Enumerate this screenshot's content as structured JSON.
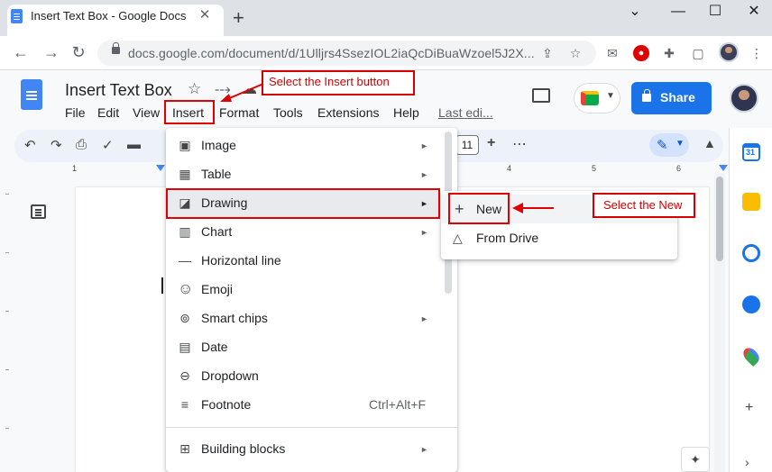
{
  "browser": {
    "tab_title": "Insert Text Box - Google Docs",
    "tab_close": "✕",
    "new_tab": "+",
    "window_controls": {
      "chevron": "⌄",
      "minimize": "—",
      "maximize": "☐",
      "close": "✕"
    },
    "nav": {
      "back": "←",
      "forward": "→",
      "reload": "↻"
    },
    "url": "docs.google.com/document/d/1Ulljrs4SsezIOL2iaQcDiBuaWzoel5J2X...",
    "extension_icons": [
      "share-icon",
      "bookmark-star-icon",
      "mail-icon",
      "adblock-icon",
      "puzzle-extensions-icon",
      "sidebar-icon",
      "more-vert-icon"
    ]
  },
  "docs": {
    "title": "Insert Text Box",
    "title_icons": {
      "star": "☆",
      "move": "⤏",
      "cloud": "☁"
    },
    "menus": [
      "File",
      "Edit",
      "View",
      "Insert",
      "Format",
      "Tools",
      "Extensions",
      "Help"
    ],
    "last_edit": "Last edi...",
    "share_label": "Share",
    "font_size": "11",
    "plus_label": "+",
    "more_label": "⋮",
    "ruler_numbers": [
      "1",
      "4",
      "5",
      "6"
    ]
  },
  "insert_menu": {
    "items": [
      {
        "label": "Image",
        "icon": "image-icon",
        "glyph": "▣",
        "submenu": true
      },
      {
        "label": "Table",
        "icon": "table-icon",
        "glyph": "▦",
        "submenu": true
      },
      {
        "label": "Drawing",
        "icon": "drawing-icon",
        "glyph": "◪",
        "submenu": true
      },
      {
        "label": "Chart",
        "icon": "chart-icon",
        "glyph": "▥",
        "submenu": true
      },
      {
        "label": "Horizontal line",
        "icon": "horizontal-line-icon",
        "glyph": "—",
        "submenu": false
      },
      {
        "label": "Emoji",
        "icon": "emoji-icon",
        "glyph": "☺",
        "submenu": false
      },
      {
        "label": "Smart chips",
        "icon": "smart-chips-icon",
        "glyph": "⊚",
        "submenu": true
      },
      {
        "label": "Date",
        "icon": "date-icon",
        "glyph": "▤",
        "submenu": false
      },
      {
        "label": "Dropdown",
        "icon": "dropdown-icon",
        "glyph": "⊖",
        "submenu": false
      },
      {
        "label": "Footnote",
        "icon": "footnote-icon",
        "glyph": "≡",
        "submenu": false,
        "shortcut": "Ctrl+Alt+F"
      },
      {
        "label": "Building blocks",
        "icon": "building-blocks-icon",
        "glyph": "⊞",
        "submenu": true
      }
    ],
    "arrow": "►"
  },
  "drawing_submenu": {
    "items": [
      {
        "label": "New",
        "glyph": "+"
      },
      {
        "label": "From Drive",
        "glyph": "△"
      }
    ]
  },
  "annotations": {
    "insert_callout": "Select the Insert button",
    "new_callout": "Select the New"
  },
  "colors": {
    "annotation_red": "#e00000",
    "share_blue": "#1a73e8",
    "docs_blue": "#4285f4"
  }
}
